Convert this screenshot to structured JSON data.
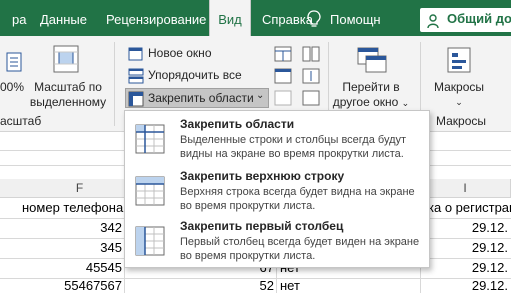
{
  "tabs": {
    "data": "Данные",
    "review": "Рецензирование",
    "view": "Вид",
    "help": "Справка",
    "assist": "Помощн",
    "shared": "Общий дос"
  },
  "ribbon": {
    "zoom_pct": "00%",
    "zoom_selection": [
      "Масштаб по",
      "выделенному"
    ],
    "new_window": "Новое окно",
    "arrange_all": "Упорядочить все",
    "freeze_panes": "Закрепить области",
    "switch_window": [
      "Перейти в",
      "другое окно"
    ],
    "macros": "Макросы",
    "group_zoom": "асштаб",
    "group_macros": "Макросы"
  },
  "menu": {
    "items": [
      {
        "title": "Закрепить области",
        "desc": "Выделенные строки и столбцы всегда будут видны на экране во время прокрутки листа."
      },
      {
        "title": "Закрепить верхнюю строку",
        "desc": "Верхняя строка всегда будет видна на экране во время прокрутки листа."
      },
      {
        "title": "Закрепить первый столбец",
        "desc": "Первый столбец всегда будет виден на экране во время прокрутки листа."
      }
    ]
  },
  "sheet": {
    "col_f": "F",
    "col_i": "I",
    "header_phone": "номер телефона",
    "header_reg": "ка о регистрац",
    "rows": [
      {
        "phone": "342",
        "g": "",
        "h": "",
        "date": "29.12."
      },
      {
        "phone": "345",
        "g": "",
        "h": "",
        "date": "29.12."
      },
      {
        "phone": "45545",
        "g": "67",
        "h": "нет",
        "date": "29.12."
      },
      {
        "phone": "55467567",
        "g": "52",
        "h": "нет",
        "date": "29.12."
      }
    ]
  }
}
